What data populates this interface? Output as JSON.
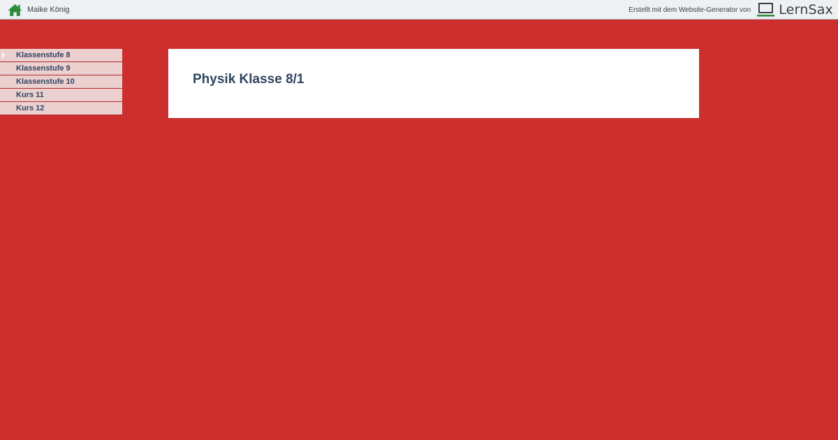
{
  "header": {
    "owner_name": "Maike König",
    "home_icon": "home-icon",
    "credit_text": "Erstellt mit dem Website-Generator von",
    "brand_name": "LernSax",
    "brand_icon": "laptop-icon"
  },
  "sidebar": {
    "items": [
      {
        "label": "Klassenstufe 8",
        "active": true
      },
      {
        "label": "Klassenstufe 9"
      },
      {
        "label": "Klassenstufe 10"
      },
      {
        "label": "Kurs 11"
      },
      {
        "label": "Kurs 12"
      }
    ]
  },
  "main": {
    "title": "Physik Klasse 8/1"
  },
  "colors": {
    "page_background": "#cd2f2f",
    "topbar_background": "#edf1f4",
    "nav_item_background": "#ecd0d0",
    "text_dark_blue": "#2f4560",
    "home_icon_green": "#2e8b3a"
  }
}
